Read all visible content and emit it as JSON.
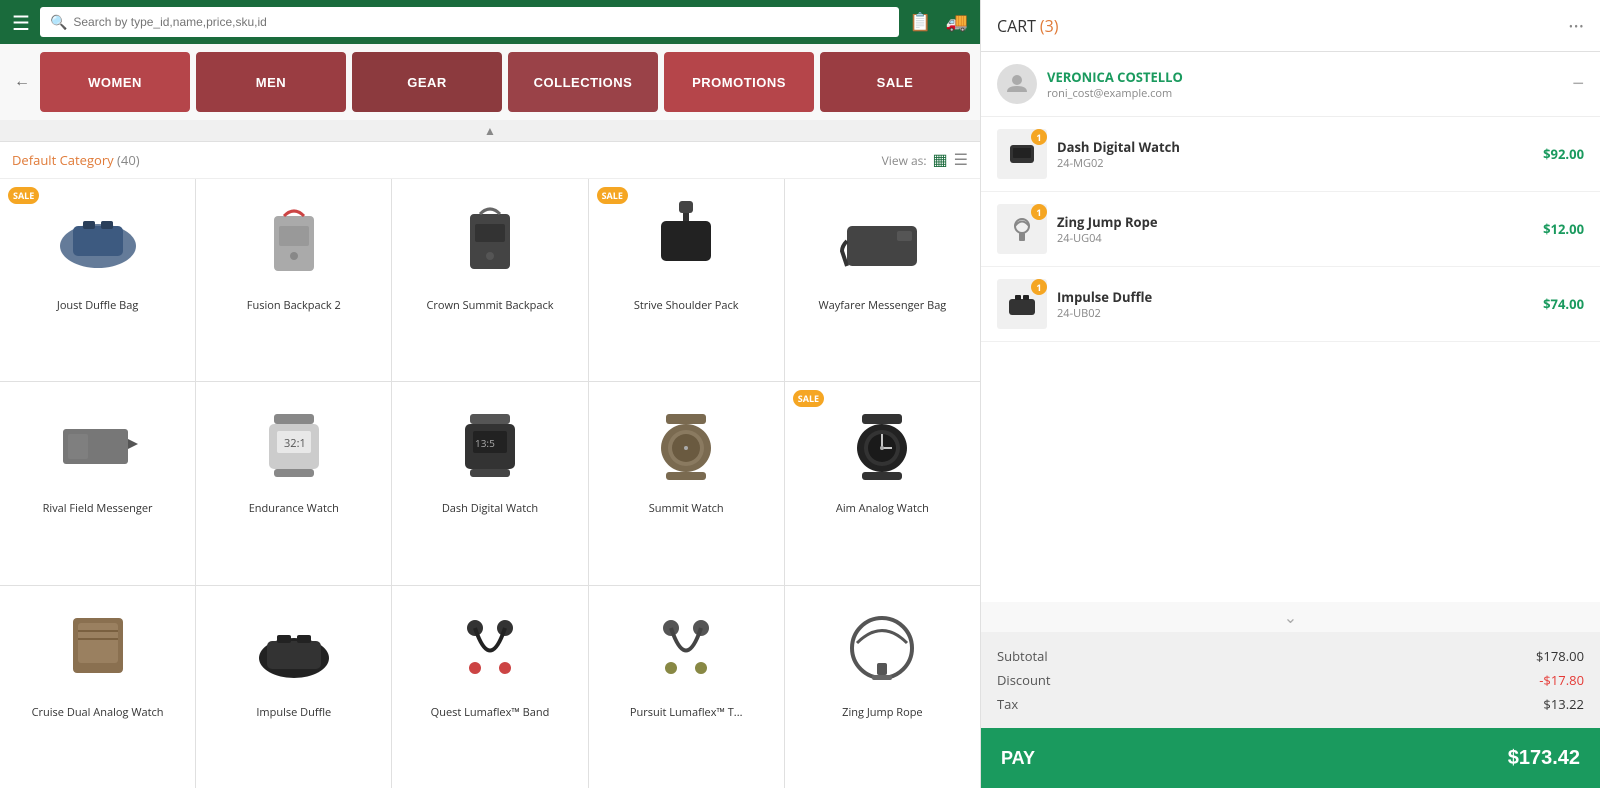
{
  "topbar": {
    "search_placeholder": "Search by type_id,name,price,sku,id"
  },
  "nav": {
    "categories": [
      {
        "label": "WOMEN",
        "class": "women"
      },
      {
        "label": "MEN",
        "class": "men"
      },
      {
        "label": "GEAR",
        "class": "gear"
      },
      {
        "label": "COLLECTIONS",
        "class": "collections"
      },
      {
        "label": "PROMOTIONS",
        "class": "promotions"
      },
      {
        "label": "SALE",
        "class": "sale"
      }
    ]
  },
  "category": {
    "title": "Default Category",
    "count": "(40)",
    "view_as_label": "View as:"
  },
  "products": [
    {
      "name": "Joust Duffle Bag",
      "sale": true,
      "color": "#3d5a80"
    },
    {
      "name": "Fusion Backpack 2",
      "sale": false,
      "color": "#888"
    },
    {
      "name": "Crown Summit Backpack",
      "sale": false,
      "color": "#444"
    },
    {
      "name": "Strive Shoulder Pack",
      "sale": true,
      "color": "#222"
    },
    {
      "name": "Wayfarer Messenger Bag",
      "sale": false,
      "color": "#333"
    },
    {
      "name": "Rival Field Messenger",
      "sale": false,
      "color": "#666"
    },
    {
      "name": "Endurance Watch",
      "sale": false,
      "color": "#888"
    },
    {
      "name": "Dash Digital Watch",
      "sale": false,
      "color": "#555"
    },
    {
      "name": "Summit Watch",
      "sale": false,
      "color": "#7a6a50"
    },
    {
      "name": "Aim Analog Watch",
      "sale": true,
      "color": "#333"
    },
    {
      "name": "Cruise Dual Analog Watch",
      "sale": false,
      "color": "#8a7050"
    },
    {
      "name": "Impulse Duffle",
      "sale": false,
      "color": "#222"
    },
    {
      "name": "Quest Lumaflex™ Band",
      "sale": false,
      "color": "#333"
    },
    {
      "name": "Pursuit Lumaflex™ T...",
      "sale": false,
      "color": "#555"
    },
    {
      "name": "Zing Jump Rope",
      "sale": false,
      "color": "#555"
    }
  ],
  "cart": {
    "title": "CART",
    "count_label": "(3)",
    "customer": {
      "name": "VERONICA COSTELLO",
      "email": "roni_cost@example.com"
    },
    "items": [
      {
        "name": "Dash Digital Watch",
        "sku": "24-MG02",
        "price": "$92.00",
        "qty": 1
      },
      {
        "name": "Zing Jump Rope",
        "sku": "24-UG04",
        "price": "$12.00",
        "qty": 1
      },
      {
        "name": "Impulse Duffle",
        "sku": "24-UB02",
        "price": "$74.00",
        "qty": 1
      }
    ],
    "subtotal_label": "Subtotal",
    "subtotal_value": "$178.00",
    "discount_label": "Discount",
    "discount_value": "-$17.80",
    "tax_label": "Tax",
    "tax_value": "$13.22",
    "pay_label": "PAY",
    "pay_total": "$173.42"
  }
}
